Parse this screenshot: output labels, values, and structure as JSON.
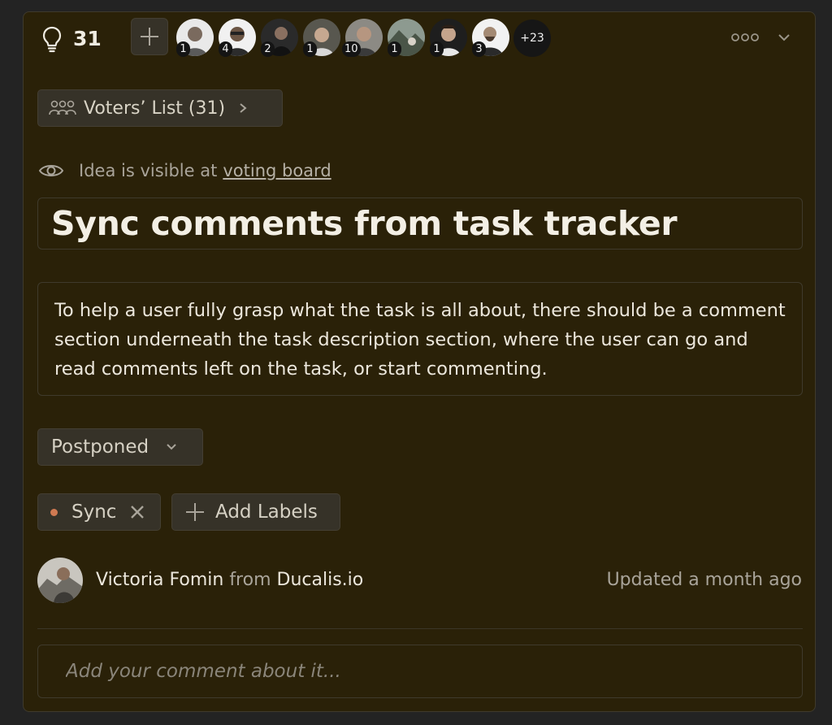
{
  "header": {
    "vote_count": "31",
    "voters": [
      {
        "count": "1",
        "color": "#8e8e8e"
      },
      {
        "count": "4",
        "color": "#9a958c"
      },
      {
        "count": "2",
        "color": "#3a3a3a"
      },
      {
        "count": "1",
        "color": "#6f6d68"
      },
      {
        "count": "10",
        "color": "#7c7972"
      },
      {
        "count": "1",
        "color": "#5f6a60"
      },
      {
        "count": "1",
        "color": "#4c4c4c"
      },
      {
        "count": "3",
        "color": "#a8a39a"
      }
    ],
    "more_voters": "+23"
  },
  "voters_list": {
    "label": "Voters’ List (31)"
  },
  "visibility": {
    "text": "Idea is visible at",
    "link": "voting board"
  },
  "idea": {
    "title": "Sync comments from task tracker",
    "description": "To help a user fully grasp what the task is all about, there should be a comment section underneath the task description section, where the user can go and read comments left on the task, or start commenting."
  },
  "status": {
    "value": "Postponed"
  },
  "labels": {
    "items": [
      {
        "name": "Sync",
        "color": "#d07a52"
      }
    ],
    "add_label": "Add Labels"
  },
  "meta": {
    "author": "Victoria Fomin",
    "from": "from",
    "org": "Ducalis.io",
    "updated": "Updated a month ago"
  },
  "comment": {
    "placeholder": "Add your comment about it..."
  },
  "colors": {
    "card_bg": "#2a2108",
    "chip_bg": "#363228",
    "label_dot": "#d07a52"
  }
}
